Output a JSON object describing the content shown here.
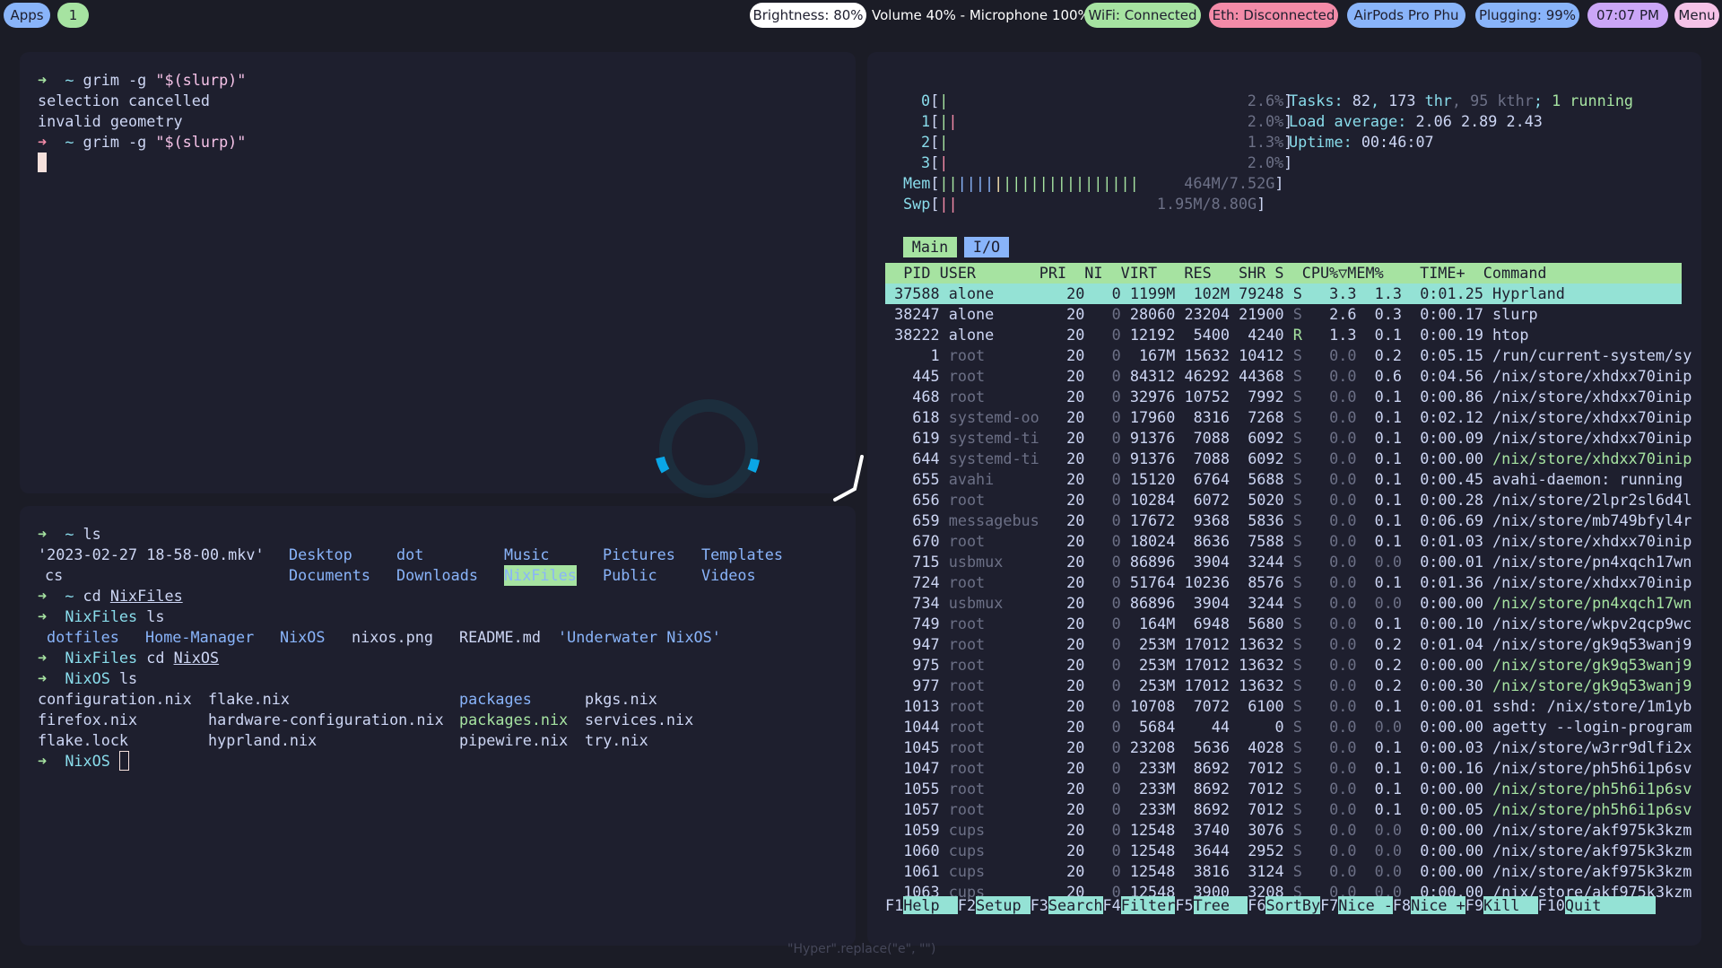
{
  "topbar": {
    "apps": "Apps",
    "workspace": "1",
    "brightness": "Brightness: 80%",
    "volume": "Volume 40% - Microphone 100%",
    "wifi": "WiFi: Connected",
    "ethernet": "Eth: Disconnected",
    "bluetooth": "AirPods Pro Phu",
    "battery": "Plugging: 99%",
    "clock": "07:07 PM",
    "menu": "Menu"
  },
  "term1": {
    "lines": [
      {
        "prompt": "~",
        "cmd": "grim -g ",
        "arg": "\"$(slurp)\""
      },
      {
        "out": "selection cancelled"
      },
      {
        "out": "invalid geometry"
      },
      {
        "prompt": "~",
        "cmd": "grim -g ",
        "arg": "\"$(slurp)\""
      }
    ]
  },
  "term2": {
    "l1_prompt": "~",
    "l1_cmd": "ls",
    "ls_home": {
      "mkv": "'2023-02-27 18-58-00.mkv'",
      "cs": "cs",
      "desktop": "Desktop",
      "documents": "Documents",
      "dot": "dot",
      "downloads": "Downloads",
      "music": "Music",
      "nixfiles": "NixFiles",
      "pictures": "Pictures",
      "public": "Public",
      "templates": "Templates",
      "videos": "Videos"
    },
    "l2_prompt": "~",
    "l2_cmd": "cd ",
    "l2_arg": "NixFiles",
    "l3_prompt": "NixFiles",
    "l3_cmd": "ls",
    "ls_nixfiles": {
      "dotfiles": "dotfiles",
      "hm": "Home-Manager",
      "nixos": "NixOS",
      "png": "nixos.png",
      "readme": "README.md",
      "underwater": "'Underwater NixOS'"
    },
    "l4_prompt": "NixFiles",
    "l4_cmd": "cd ",
    "l4_arg": "NixOS",
    "l5_prompt": "NixOS",
    "l5_cmd": "ls",
    "ls_nixos": {
      "c1": [
        "configuration.nix",
        "firefox.nix",
        "flake.lock"
      ],
      "c2": [
        "flake.nix",
        "hardware-configuration.nix",
        "hyprland.nix"
      ],
      "c3": [
        "packages",
        "packages.nix",
        "pipewire.nix"
      ],
      "c4": [
        "pkgs.nix",
        "services.nix",
        "try.nix"
      ]
    },
    "l6_prompt": "NixOS"
  },
  "htop": {
    "cpus": [
      {
        "id": "0",
        "pct": "2.6%"
      },
      {
        "id": "1",
        "pct": "2.0%"
      },
      {
        "id": "2",
        "pct": "1.3%"
      },
      {
        "id": "3",
        "pct": "2.0%"
      }
    ],
    "mem": "464M/7.52G",
    "swp": "1.95M/8.80G",
    "tasks_label": "Tasks: ",
    "tasks": "82",
    "thr": "173",
    "kthr": "95",
    "running": "1",
    "load_label": "Load average: ",
    "load": "2.06 2.89 2.43",
    "uptime_label": "Uptime: ",
    "uptime": "00:46:07",
    "tab_main": "Main",
    "tab_io": "I/O",
    "header": "  PID USER       PRI  NI  VIRT   RES   SHR S  CPU%▽MEM%    TIME+  Command",
    "rows": [
      [
        "37588",
        "alone",
        "20",
        "0",
        "1199M",
        "102M",
        "79248",
        "S",
        "3.3",
        "1.3",
        "0:01.25",
        "Hyprland"
      ],
      [
        "38247",
        "alone",
        "20",
        "0",
        "28060",
        "23204",
        "21900",
        "S",
        "2.6",
        "0.3",
        "0:00.17",
        "slurp"
      ],
      [
        "38222",
        "alone",
        "20",
        "0",
        "12192",
        "5400",
        "4240",
        "R",
        "1.3",
        "0.1",
        "0:00.19",
        "htop"
      ],
      [
        "1",
        "root",
        "20",
        "0",
        "167M",
        "15632",
        "10412",
        "S",
        "0.0",
        "0.2",
        "0:05.15",
        "/run/current-system/sy"
      ],
      [
        "445",
        "root",
        "20",
        "0",
        "84312",
        "46292",
        "44368",
        "S",
        "0.0",
        "0.6",
        "0:04.56",
        "/nix/store/xhdxx70inip"
      ],
      [
        "468",
        "root",
        "20",
        "0",
        "32976",
        "10752",
        "7992",
        "S",
        "0.0",
        "0.1",
        "0:00.86",
        "/nix/store/xhdxx70inip"
      ],
      [
        "618",
        "systemd-oo",
        "20",
        "0",
        "17960",
        "8316",
        "7268",
        "S",
        "0.0",
        "0.1",
        "0:02.12",
        "/nix/store/xhdxx70inip"
      ],
      [
        "619",
        "systemd-ti",
        "20",
        "0",
        "91376",
        "7088",
        "6092",
        "S",
        "0.0",
        "0.1",
        "0:00.09",
        "/nix/store/xhdxx70inip"
      ],
      [
        "644",
        "systemd-ti",
        "20",
        "0",
        "91376",
        "7088",
        "6092",
        "S",
        "0.0",
        "0.1",
        "0:00.00",
        "/nix/store/xhdxx70inip"
      ],
      [
        "655",
        "avahi",
        "20",
        "0",
        "15120",
        "6764",
        "5688",
        "S",
        "0.0",
        "0.1",
        "0:00.45",
        "avahi-daemon: running"
      ],
      [
        "656",
        "root",
        "20",
        "0",
        "10284",
        "6072",
        "5020",
        "S",
        "0.0",
        "0.1",
        "0:00.28",
        "/nix/store/2lpr2sl6d4l"
      ],
      [
        "659",
        "messagebus",
        "20",
        "0",
        "17672",
        "9368",
        "5836",
        "S",
        "0.0",
        "0.1",
        "0:06.69",
        "/nix/store/mb749bfyl4r"
      ],
      [
        "670",
        "root",
        "20",
        "0",
        "18024",
        "8636",
        "7588",
        "S",
        "0.0",
        "0.1",
        "0:01.03",
        "/nix/store/xhdxx70inip"
      ],
      [
        "715",
        "usbmux",
        "20",
        "0",
        "86896",
        "3904",
        "3244",
        "S",
        "0.0",
        "0.0",
        "0:00.01",
        "/nix/store/pn4xqch17wn"
      ],
      [
        "724",
        "root",
        "20",
        "0",
        "51764",
        "10236",
        "8576",
        "S",
        "0.0",
        "0.1",
        "0:01.36",
        "/nix/store/xhdxx70inip"
      ],
      [
        "734",
        "usbmux",
        "20",
        "0",
        "86896",
        "3904",
        "3244",
        "S",
        "0.0",
        "0.0",
        "0:00.00",
        "/nix/store/pn4xqch17wn"
      ],
      [
        "749",
        "root",
        "20",
        "0",
        "164M",
        "6948",
        "5680",
        "S",
        "0.0",
        "0.1",
        "0:00.10",
        "/nix/store/wkpv2qcp9wc"
      ],
      [
        "947",
        "root",
        "20",
        "0",
        "253M",
        "17012",
        "13632",
        "S",
        "0.0",
        "0.2",
        "0:01.04",
        "/nix/store/gk9q53wanj9"
      ],
      [
        "975",
        "root",
        "20",
        "0",
        "253M",
        "17012",
        "13632",
        "S",
        "0.0",
        "0.2",
        "0:00.00",
        "/nix/store/gk9q53wanj9"
      ],
      [
        "977",
        "root",
        "20",
        "0",
        "253M",
        "17012",
        "13632",
        "S",
        "0.0",
        "0.2",
        "0:00.30",
        "/nix/store/gk9q53wanj9"
      ],
      [
        "1013",
        "root",
        "20",
        "0",
        "10708",
        "7072",
        "6100",
        "S",
        "0.0",
        "0.1",
        "0:00.01",
        "sshd: /nix/store/1m1yb"
      ],
      [
        "1044",
        "root",
        "20",
        "0",
        "5684",
        "44",
        "0",
        "S",
        "0.0",
        "0.0",
        "0:00.00",
        "agetty --login-program"
      ],
      [
        "1045",
        "root",
        "20",
        "0",
        "23208",
        "5636",
        "4028",
        "S",
        "0.0",
        "0.1",
        "0:00.03",
        "/nix/store/w3rr9dlfi2x"
      ],
      [
        "1047",
        "root",
        "20",
        "0",
        "233M",
        "8692",
        "7012",
        "S",
        "0.0",
        "0.1",
        "0:00.16",
        "/nix/store/ph5h6i1p6sv"
      ],
      [
        "1055",
        "root",
        "20",
        "0",
        "233M",
        "8692",
        "7012",
        "S",
        "0.0",
        "0.1",
        "0:00.00",
        "/nix/store/ph5h6i1p6sv"
      ],
      [
        "1057",
        "root",
        "20",
        "0",
        "233M",
        "8692",
        "7012",
        "S",
        "0.0",
        "0.1",
        "0:00.05",
        "/nix/store/ph5h6i1p6sv"
      ],
      [
        "1059",
        "cups",
        "20",
        "0",
        "12548",
        "3740",
        "3076",
        "S",
        "0.0",
        "0.0",
        "0:00.00",
        "/nix/store/akf975k3kzm"
      ],
      [
        "1060",
        "cups",
        "20",
        "0",
        "12548",
        "3644",
        "2952",
        "S",
        "0.0",
        "0.0",
        "0:00.00",
        "/nix/store/akf975k3kzm"
      ],
      [
        "1061",
        "cups",
        "20",
        "0",
        "12548",
        "3816",
        "3124",
        "S",
        "0.0",
        "0.0",
        "0:00.00",
        "/nix/store/akf975k3kzm"
      ],
      [
        "1063",
        "cups",
        "20",
        "0",
        "12548",
        "3900",
        "3208",
        "S",
        "0.0",
        "0.0",
        "0:00.00",
        "/nix/store/akf975k3kzm"
      ]
    ],
    "thread_rows": [
      8,
      15,
      18,
      19,
      24,
      25
    ],
    "fkeys": [
      {
        "k": "F1",
        "l": "Help  "
      },
      {
        "k": "F2",
        "l": "Setup "
      },
      {
        "k": "F3",
        "l": "Search"
      },
      {
        "k": "F4",
        "l": "Filter"
      },
      {
        "k": "F5",
        "l": "Tree  "
      },
      {
        "k": "F6",
        "l": "SortBy"
      },
      {
        "k": "F7",
        "l": "Nice -"
      },
      {
        "k": "F8",
        "l": "Nice +"
      },
      {
        "k": "F9",
        "l": "Kill  "
      },
      {
        "k": "F10",
        "l": "Quit      "
      }
    ]
  },
  "caption": "\"Hyper\".replace(\"e\", \"\")"
}
